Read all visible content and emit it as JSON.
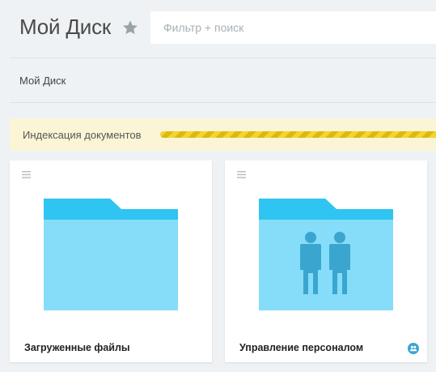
{
  "header": {
    "title": "Мой Диск",
    "star_icon": "star-icon",
    "search_placeholder": "Фильтр + поиск"
  },
  "breadcrumb": {
    "label": "Мой Диск"
  },
  "indexing": {
    "label": "Индексация документов",
    "progress": 1.0,
    "colors": {
      "background": "#fbf5d6",
      "stripe_light": "#f3d431",
      "stripe_dark": "#dcb90f"
    }
  },
  "folders": [
    {
      "name": "Загруженные файлы",
      "icon": "folder-icon",
      "shared": false
    },
    {
      "name": "Управление персоналом",
      "icon": "folder-people-icon",
      "shared": true,
      "badge_icon": "shared-users-icon"
    }
  ],
  "colors": {
    "page_bg": "#eef2f4",
    "folder_tab": "#2fc4f2",
    "folder_body": "#86ddf9",
    "people": "#3aa6d0",
    "badge": "#3aa6d0"
  }
}
